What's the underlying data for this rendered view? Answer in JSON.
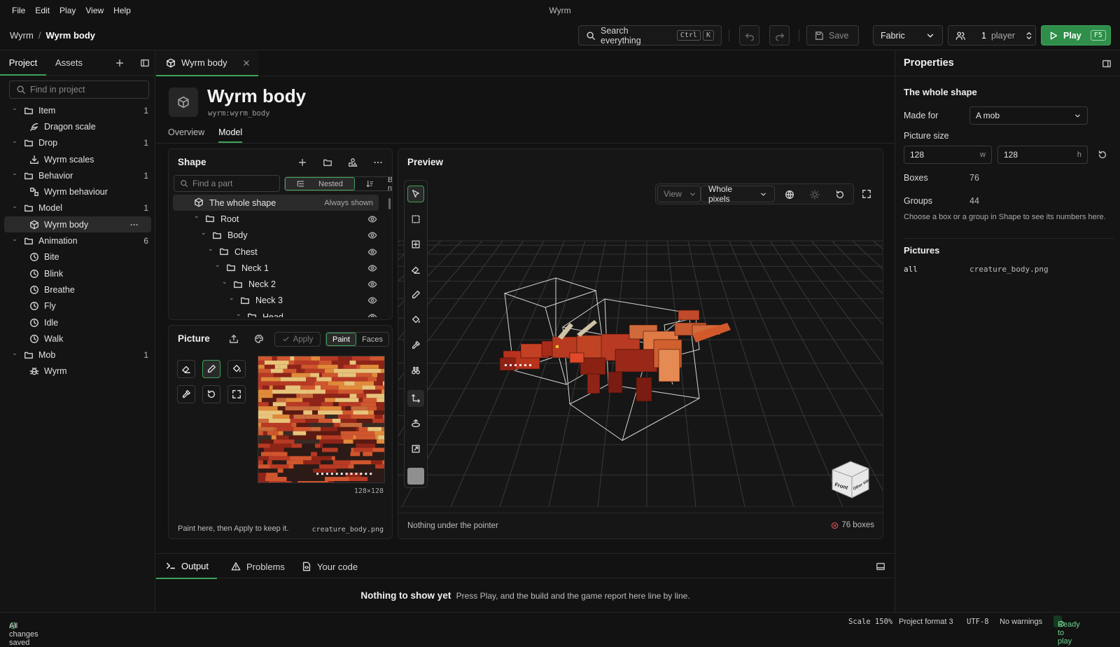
{
  "window": {
    "title": "Wyrm"
  },
  "menu": [
    "File",
    "Edit",
    "Play",
    "View",
    "Help"
  ],
  "breadcrumb": {
    "root": "Wyrm",
    "sep": "/",
    "current": "Wyrm body"
  },
  "toolbar": {
    "search": "Search everything",
    "search_kbd1": "Ctrl",
    "search_kbd2": "K",
    "save": "Save",
    "loader": "Fabric",
    "players_count": "1",
    "players_label": "player",
    "play": "Play",
    "play_kbd": "F5"
  },
  "left": {
    "tab_project": "Project",
    "tab_assets": "Assets",
    "search_placeholder": "Find in project",
    "tree": [
      {
        "label": "Item",
        "count": "1",
        "folder": true,
        "icon": "folder-icon"
      },
      {
        "label": "Dragon scale",
        "child": true,
        "icon": "feather-icon"
      },
      {
        "label": "Drop",
        "count": "1",
        "folder": true,
        "icon": "folder-icon"
      },
      {
        "label": "Wyrm scales",
        "child": true,
        "icon": "download-icon"
      },
      {
        "label": "Behavior",
        "count": "1",
        "folder": true,
        "icon": "folder-icon"
      },
      {
        "label": "Wyrm behaviour",
        "child": true,
        "icon": "nodes-icon"
      },
      {
        "label": "Model",
        "count": "1",
        "folder": true,
        "icon": "folder-icon"
      },
      {
        "label": "Wyrm body",
        "child": true,
        "selected": true,
        "icon": "cube-icon"
      },
      {
        "label": "Animation",
        "count": "6",
        "folder": true,
        "icon": "folder-icon"
      },
      {
        "label": "Bite",
        "child": true,
        "icon": "clock-icon"
      },
      {
        "label": "Blink",
        "child": true,
        "icon": "clock-icon"
      },
      {
        "label": "Breathe",
        "child": true,
        "icon": "clock-icon"
      },
      {
        "label": "Fly",
        "child": true,
        "icon": "clock-icon"
      },
      {
        "label": "Idle",
        "child": true,
        "icon": "clock-icon"
      },
      {
        "label": "Walk",
        "child": true,
        "icon": "clock-icon"
      },
      {
        "label": "Mob",
        "count": "1",
        "folder": true,
        "icon": "folder-icon"
      },
      {
        "label": "Wyrm",
        "child": true,
        "icon": "bug-icon"
      }
    ]
  },
  "editor": {
    "tab": "Wyrm body",
    "title": "Wyrm body",
    "id": "wyrm:wyrm_body",
    "subtab_overview": "Overview",
    "subtab_model": "Model"
  },
  "shape": {
    "title": "Shape",
    "search_placeholder": "Find a part",
    "mode_nested": "Nested",
    "mode_byname": "By name",
    "rows": [
      {
        "label": "The whole shape",
        "note": "Always shown",
        "depth": 0
      },
      {
        "label": "Root",
        "depth": 1
      },
      {
        "label": "Body",
        "depth": 2
      },
      {
        "label": "Chest",
        "depth": 3
      },
      {
        "label": "Neck 1",
        "depth": 4
      },
      {
        "label": "Neck 2",
        "depth": 5
      },
      {
        "label": "Neck 3",
        "depth": 6
      },
      {
        "label": "Head",
        "depth": 7
      }
    ]
  },
  "picture": {
    "title": "Picture",
    "apply": "Apply",
    "mode_paint": "Paint",
    "mode_faces": "Faces",
    "size": "128×128",
    "hint": "Paint here, then Apply to keep it.",
    "file": "creature_body.png"
  },
  "preview": {
    "title": "Preview",
    "view": "View",
    "pixels": "Whole pixels",
    "status": "Nothing under the pointer",
    "boxes": "76 boxes",
    "cube_front": "Front",
    "cube_side": "Other side"
  },
  "properties": {
    "title": "Properties",
    "section": "The whole shape",
    "made_for_label": "Made for",
    "made_for": "A mob",
    "picture_size_label": "Picture size",
    "w": "128",
    "w_unit": "w",
    "h": "128",
    "h_unit": "h",
    "boxes_label": "Boxes",
    "boxes": "76",
    "groups_label": "Groups",
    "groups": "44",
    "hint": "Choose a box or a group in Shape to see its numbers here.",
    "pictures_title": "Pictures",
    "pic_key": "all",
    "pic_file": "creature_body.png"
  },
  "bottom": {
    "tab_output": "Output",
    "tab_problems": "Problems",
    "tab_code": "Your code",
    "empty_title": "Nothing to show yet",
    "empty_text": "Press Play, and the build and the game report here line by line."
  },
  "status": {
    "saved": "All changes saved",
    "scale": "Scale 150%",
    "format": "Project format 3",
    "encoding": "UTF-8",
    "warnings": "No warnings",
    "ready": "Ready to play"
  },
  "colors": {
    "accent": "#3da35a",
    "play": "#2f8f4a",
    "warn": "#e05050"
  }
}
